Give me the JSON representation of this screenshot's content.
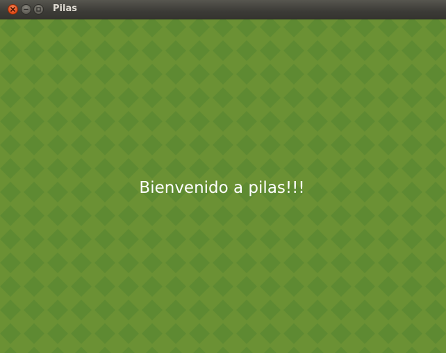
{
  "window": {
    "title": "Pilas",
    "controls": {
      "close_icon": "close-icon",
      "minimize_icon": "minimize-icon",
      "maximize_icon": "maximize-icon"
    }
  },
  "canvas": {
    "message": "Bienvenido a pilas!!!",
    "colors": {
      "background": "#6b9134",
      "diamond": "#5d8a31",
      "text": "#ffffff"
    }
  }
}
